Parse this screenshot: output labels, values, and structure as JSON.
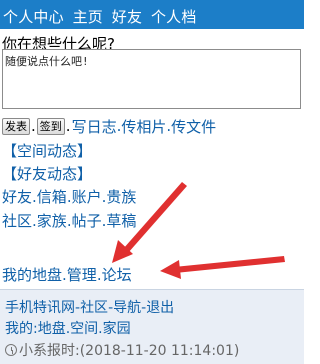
{
  "header": {
    "partial_text": "→( 　←)",
    "nav": [
      "个人中心",
      "主页",
      "好友",
      "个人档"
    ]
  },
  "status": {
    "prompt": "你在想些什么呢?",
    "placeholder": "随便说点什么吧!"
  },
  "actions": {
    "publish": "发表",
    "signin": "签到",
    "links": [
      "写日志",
      "传相片",
      "传文件"
    ]
  },
  "sections": {
    "space_updates": "【空间动态】",
    "friend_updates": "【好友动态】",
    "row1": [
      "好友",
      "信箱",
      "账户",
      "贵族"
    ],
    "row2": [
      "社区",
      "家族",
      "帖子",
      "草稿"
    ],
    "row3": [
      "我的地盘",
      "管理",
      "论坛"
    ]
  },
  "footer": {
    "row1": [
      "手机特讯网",
      "社区",
      "导航",
      "退出"
    ],
    "row2_prefix": "我的:",
    "row2": [
      "地盘",
      "空间",
      "家园"
    ],
    "report": "小系报时:(2018-11-20 11:14:01)"
  },
  "colors": {
    "header_bg": "#1c7ec8",
    "link": "#1060a8",
    "arrow": "#e03030",
    "footer_bg": "#e9eef6"
  }
}
